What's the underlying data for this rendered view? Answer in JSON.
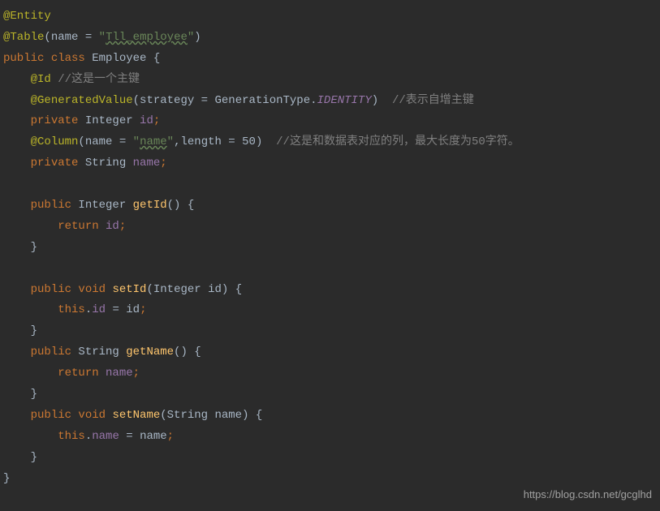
{
  "code": {
    "line1": {
      "a": "@Entity"
    },
    "line2": {
      "a": "@Table",
      "p1": "(",
      "attr": "name",
      "eq": " = ",
      "q1": "\"",
      "str": "Tll_employee",
      "q2": "\"",
      "p2": ")"
    },
    "line3": {
      "kw1": "public ",
      "kw2": "class ",
      "name": "Employee ",
      "br": "{"
    },
    "line4": {
      "indent": "    ",
      "a": "@Id",
      "sp": " ",
      "cm": "//这是一个主键"
    },
    "line5": {
      "indent": "    ",
      "a": "@GeneratedValue",
      "p1": "(",
      "attr": "strategy",
      "eq": " = ",
      "cls": "GenerationType",
      "dot": ".",
      "fld": "IDENTITY",
      "p2": ")",
      "sp": "  ",
      "cm": "//表示自增主键"
    },
    "line6": {
      "indent": "    ",
      "kw": "private ",
      "type": "Integer ",
      "fld": "id",
      "sc": ";"
    },
    "line7": {
      "indent": "    ",
      "a": "@Column",
      "p1": "(",
      "attr1": "name",
      "eq1": " = ",
      "q1": "\"",
      "str": "name",
      "q2": "\"",
      "comma": ",",
      "attr2": "length",
      "eq2": " = ",
      "num": "50",
      "p2": ")",
      "sp": "  ",
      "cm": "//这是和数据表对应的列，最大长度为50字符。"
    },
    "line8": {
      "indent": "    ",
      "kw": "private ",
      "type": "String ",
      "fld": "name",
      "sc": ";"
    },
    "line9": {
      "blank": " "
    },
    "line10": {
      "indent": "    ",
      "kw": "public ",
      "type": "Integer ",
      "mth": "getId",
      "p": "() ",
      "br": "{"
    },
    "line11": {
      "indent": "        ",
      "kw": "return ",
      "fld": "id",
      "sc": ";"
    },
    "line12": {
      "indent": "    ",
      "br": "}"
    },
    "line13": {
      "blank": " "
    },
    "line14": {
      "indent": "    ",
      "kw1": "public ",
      "kw2": "void ",
      "mth": "setId",
      "p1": "(",
      "type": "Integer ",
      "param": "id",
      "p2": ") ",
      "br": "{"
    },
    "line15": {
      "indent": "        ",
      "this": "this",
      "dot": ".",
      "fld": "id",
      "eq": " = ",
      "param": "id",
      "sc": ";"
    },
    "line16": {
      "indent": "    ",
      "br": "}"
    },
    "line17": {
      "indent": "    ",
      "kw": "public ",
      "type": "String ",
      "mth": "getName",
      "p": "() ",
      "br": "{"
    },
    "line18": {
      "indent": "        ",
      "kw": "return ",
      "fld": "name",
      "sc": ";"
    },
    "line19": {
      "indent": "    ",
      "br": "}"
    },
    "line20": {
      "indent": "    ",
      "kw1": "public ",
      "kw2": "void ",
      "mth": "setName",
      "p1": "(",
      "type": "String ",
      "param": "name",
      "p2": ") ",
      "br": "{"
    },
    "line21": {
      "indent": "        ",
      "this": "this",
      "dot": ".",
      "fld": "name",
      "eq": " = ",
      "param": "name",
      "sc": ";"
    },
    "line22": {
      "indent": "    ",
      "br": "}"
    },
    "line23": {
      "br": "}"
    }
  },
  "watermark": "https://blog.csdn.net/gcglhd"
}
